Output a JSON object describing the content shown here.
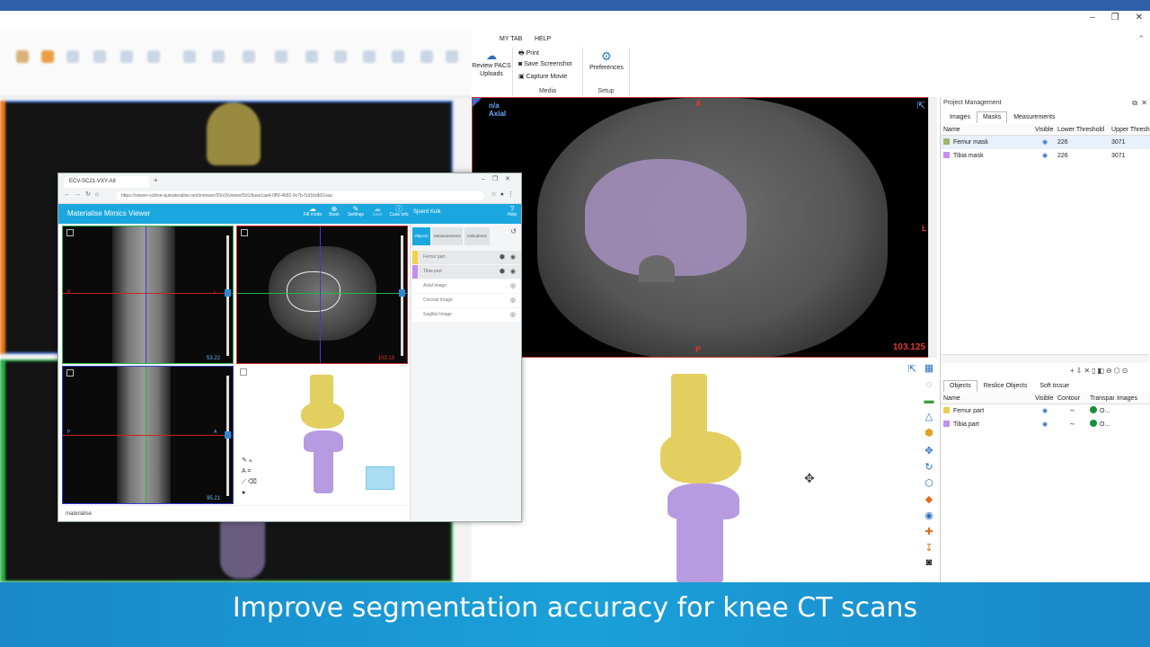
{
  "ribbon": {
    "tabs": [
      "MY TAB",
      "HELP"
    ],
    "review_pacs": "Review PACS\nUploads",
    "print": "Print",
    "save_screenshot": "Save Screenshot",
    "capture_movie": "Capture Movie",
    "media_label": "Media",
    "preferences": "Preferences",
    "setup_label": "Setup"
  },
  "axial_view": {
    "info_line1": "n/a",
    "info_line2": "Axial",
    "dir_top": "A",
    "dir_bottom": "P",
    "dir_right": "L",
    "slice_value": "103.125"
  },
  "project_panel": {
    "title": "Project Management",
    "tabs": [
      "Images",
      "Masks",
      "Measurements"
    ],
    "active_tab": "Masks",
    "mask_columns": [
      "Name",
      "Visible",
      "Lower Threshold",
      "Upper Threshold"
    ],
    "masks": [
      {
        "name": "Femur mask",
        "color": "#a8b46a",
        "lower": "226",
        "upper": "3071"
      },
      {
        "name": "Tibia mask",
        "color": "#c48ff0",
        "lower": "226",
        "upper": "3071"
      }
    ],
    "object_tabs": [
      "Objects",
      "Reslice Objects",
      "Soft tissue"
    ],
    "object_columns": [
      "Name",
      "Visible",
      "Contour",
      "Transparency",
      "Images"
    ],
    "objects": [
      {
        "name": "Femur part",
        "color": "#e8d050",
        "trans": "O..."
      },
      {
        "name": "Tibia part",
        "color": "#c48ff0",
        "trans": "O..."
      }
    ]
  },
  "viewer": {
    "browser_tab": "ECV-SC21-VXY-AII",
    "url": "https://viewer-sctrive-qumateralise.net/srviewer/25/v3/viewer/591/tlase1aa4-0f5f-4682-9c7b-f1d1bdb51eac",
    "brand": "Materialise Mimics Viewer",
    "header_buttons": [
      "Fill mode",
      "Book",
      "Settings",
      "Save",
      "Case info"
    ],
    "user": "Sjoerd Kolk",
    "help": "Help",
    "side_tabs": [
      "Objects",
      "Measurements",
      "Indications"
    ],
    "objects": [
      {
        "name": "Femur part",
        "color": "#f2d24a"
      },
      {
        "name": "Tibia part",
        "color": "#c48ff0"
      },
      {
        "name": "Axial Image",
        "color": ""
      },
      {
        "name": "Coronal Image",
        "color": ""
      },
      {
        "name": "Sagittal Image",
        "color": ""
      }
    ],
    "pane_values": [
      "53.22",
      "103.13",
      "95.21"
    ],
    "pane_labels": {
      "r": "R",
      "l": "L",
      "a": "A",
      "p": "P",
      "d": "D"
    },
    "footer_logo": "materialise"
  },
  "caption": "Improve segmentation accuracy for knee CT scans",
  "icons": [
    "minimize-icon",
    "restore-icon",
    "close-icon",
    "gear-icon",
    "print-icon",
    "camera-icon",
    "film-icon",
    "move-icon"
  ]
}
